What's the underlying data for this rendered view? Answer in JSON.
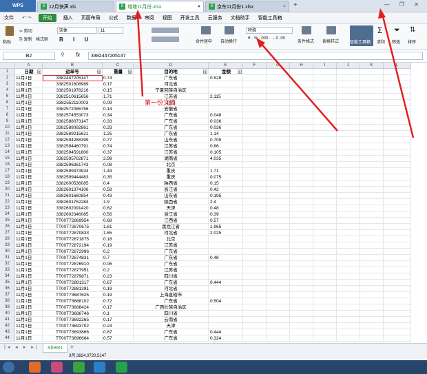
{
  "app": {
    "name": "WPS"
  },
  "tabs": [
    {
      "label": "12月快声.xls"
    },
    {
      "label": "城塘11月份.xlsx"
    },
    {
      "label": "京东11月份1.xlsx"
    }
  ],
  "menu": [
    "文件",
    "开始",
    "插入",
    "页面布局",
    "公式",
    "数据",
    "审阅",
    "视图",
    "开发工具",
    "云服务",
    "文档助手",
    "智能工具箱"
  ],
  "ribbon": {
    "cut": "剪切",
    "paste": "粘贴",
    "copy": "复制",
    "format_painter": "格式刷",
    "font": "宋体",
    "font_size": "11",
    "merge": "合并居中",
    "wrap": "自动换行",
    "number_format": "特殊",
    "cond_format": "条件格式",
    "table_style": "表格样式",
    "smart_tools": "智能工具箱",
    "sum": "求和",
    "filter": "筛选",
    "sort": "排序"
  },
  "formula_bar": {
    "cell_ref": "B2",
    "fx": "fx",
    "value": "3382447205147"
  },
  "columns": [
    "A",
    "B",
    "C",
    "D",
    "E",
    "F",
    "G",
    "H",
    "I",
    "J",
    "K",
    "L"
  ],
  "header_row": [
    "日期",
    "运单号",
    "重量",
    "目的地",
    "金额"
  ],
  "rows": [
    [
      "11月1日",
      "3382447205147",
      "0.74",
      "广东省",
      "0.528"
    ],
    [
      "11月1日",
      "3382501608989",
      "0.17",
      "河北省",
      ""
    ],
    [
      "11月1日",
      "3382501978216",
      "0.15",
      "宁夏回族自治区",
      ""
    ],
    [
      "11月1日",
      "3382510615656",
      "1.71",
      "江苏省",
      "2.115"
    ],
    [
      "11月1日",
      "3382552110003",
      "0.09",
      "北京",
      ""
    ],
    [
      "11月1日",
      "3382572086756",
      "0.14",
      "安徽省",
      ""
    ],
    [
      "11月1日",
      "3382574553073",
      "0.34",
      "广东省",
      "0.048"
    ],
    [
      "11月1日",
      "3382588073147",
      "0.33",
      "广东省",
      "0.036"
    ],
    [
      "11月1日",
      "3382588082861",
      "0.33",
      "广东省",
      "0.036"
    ],
    [
      "11月1日",
      "3382589215621",
      "1.25",
      "广东省",
      "1.14"
    ],
    [
      "11月1日",
      "3382594268399",
      "0.77",
      "山东省",
      "0.705"
    ],
    [
      "11月1日",
      "3382594460791",
      "0.74",
      "江苏省",
      "0.66"
    ],
    [
      "11月1日",
      "3382594591800",
      "0.37",
      "江苏省",
      "0.105"
    ],
    [
      "11月1日",
      "3382595762871",
      "2.99",
      "湖南省",
      "4.035"
    ],
    [
      "11月1日",
      "3382596361743",
      "0.08",
      "北京",
      ""
    ],
    [
      "11月1日",
      "3382599373934",
      "1.44",
      "重庆",
      "1.71"
    ],
    [
      "11月1日",
      "3382599444483",
      "0.35",
      "重庆",
      "0.075"
    ],
    [
      "11月1日",
      "3382600536085",
      "0.4",
      "陕西省",
      "0.15"
    ],
    [
      "11月1日",
      "3382601374106",
      "0.58",
      "浙江省",
      "0.42"
    ],
    [
      "11月1日",
      "3382601660854",
      "0.43",
      "山东省",
      "0.195"
    ],
    [
      "11月1日",
      "3382601752284",
      "1.9",
      "陕西省",
      "2.4"
    ],
    [
      "11月1日",
      "3382602091420",
      "0.62",
      "天津",
      "0.48"
    ],
    [
      "11月1日",
      "3382602346085",
      "0.56",
      "浙江省",
      "0.39"
    ],
    [
      "11月1日",
      "TT00T72869954",
      "0.68",
      "江西省",
      "0.57"
    ],
    [
      "11月1日",
      "TT00T72870675",
      "1.61",
      "黑龙江省",
      "1.965"
    ],
    [
      "11月1日",
      "TT00T72870833",
      "1.65",
      "河北省",
      "2.025"
    ],
    [
      "11月1日",
      "TT00T72871875",
      "0.18",
      "北京",
      ""
    ],
    [
      "11月1日",
      "TT00T72872194",
      "0.19",
      "江苏省",
      ""
    ],
    [
      "11月1日",
      "TT00T72872996",
      "0.2",
      "广东省",
      ""
    ],
    [
      "11月1日",
      "TT00T72874831",
      "0.7",
      "广东省",
      "0.48"
    ],
    [
      "11月1日",
      "TT00T72876910",
      "0.06",
      "广东省",
      ""
    ],
    [
      "11月1日",
      "TT00T72877951",
      "0.2",
      "江苏省",
      ""
    ],
    [
      "11月1日",
      "TT00T72879871",
      "0.23",
      "四川省",
      ""
    ],
    [
      "11月1日",
      "TT00T72881317",
      "0.67",
      "广东省",
      "0.444"
    ],
    [
      "11月1日",
      "TT00T72881391",
      "0.19",
      "河北省",
      ""
    ],
    [
      "11月1日",
      "TT00T73687625",
      "0.19",
      "上海直辖市",
      ""
    ],
    [
      "11月1日",
      "TT00T73688102",
      "0.72",
      "广东省",
      "0.504"
    ],
    [
      "11月1日",
      "TT00T73688424",
      "0.17",
      "广西壮族自治区",
      ""
    ],
    [
      "11月1日",
      "TT00T73688746",
      "0.1",
      "四川省",
      ""
    ],
    [
      "11月1日",
      "TT00T73692265",
      "0.17",
      "云南省",
      ""
    ],
    [
      "11月1日",
      "TT00T73693702",
      "0.24",
      "天津",
      ""
    ],
    [
      "11月1日",
      "TT00T73693866",
      "0.67",
      "广东省",
      "0.444"
    ],
    [
      "11月1日",
      "TT00T73696664",
      "0.57",
      "广东省",
      "0.324"
    ]
  ],
  "annotation": "第一份文档",
  "sheet_tab": "Sheet1",
  "status": "3月,3824,0720,5147",
  "colors": {
    "accent": "#2e8b3e",
    "annotation": "#e02020"
  }
}
